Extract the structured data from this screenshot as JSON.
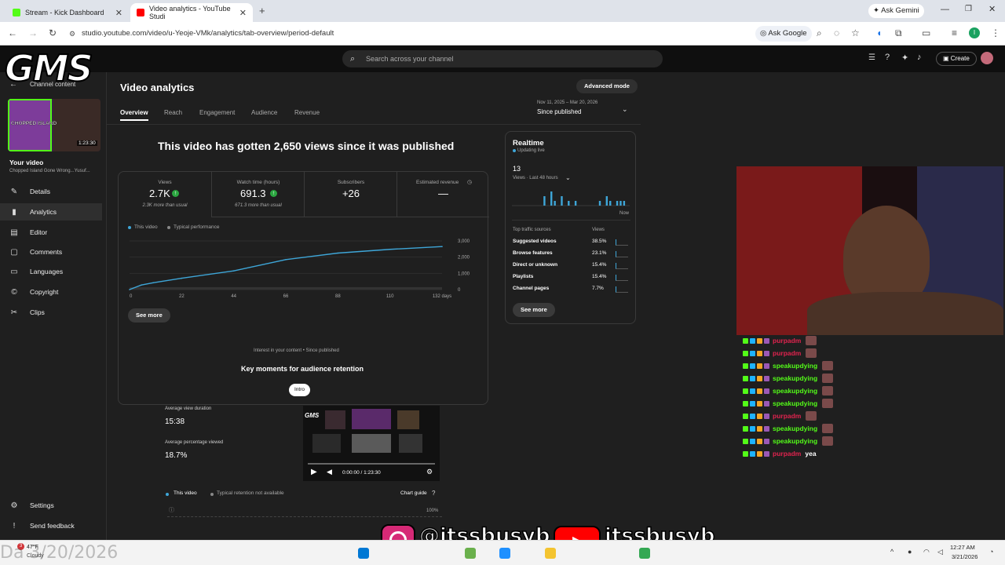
{
  "browser": {
    "tabs": [
      {
        "title": "Stream - Kick Dashboard",
        "favicon_color": "#53fc18"
      },
      {
        "title": "Video analytics - YouTube Studi",
        "favicon_color": "#ff0000"
      }
    ],
    "new_tab": "+",
    "url": "studio.youtube.com/video/u-Yeoje-VMk/analytics/tab-overview/period-default",
    "ask_google": "Ask Google",
    "ask_gemini": "Ask Gemini",
    "profile_initial": "I"
  },
  "studio": {
    "search_placeholder": "Search across your channel",
    "create_label": "Create",
    "sidebar": {
      "channel_content": "Channel content",
      "thumb_title": "CHOPPED ISLAND",
      "thumb_duration": "1:23:30",
      "your_video": "Your video",
      "video_title": "Chopped Island Gone Wrong...Yusuf...",
      "items": [
        {
          "label": "Details",
          "icon": "pencil-icon"
        },
        {
          "label": "Analytics",
          "icon": "analytics-icon"
        },
        {
          "label": "Editor",
          "icon": "editor-icon"
        },
        {
          "label": "Comments",
          "icon": "comments-icon"
        },
        {
          "label": "Languages",
          "icon": "subtitles-icon"
        },
        {
          "label": "Copyright",
          "icon": "copyright-icon"
        },
        {
          "label": "Clips",
          "icon": "scissors-icon"
        }
      ],
      "settings": "Settings",
      "send_feedback": "Send feedback"
    },
    "analytics": {
      "title": "Video analytics",
      "advanced_mode": "Advanced mode",
      "tabs": [
        "Overview",
        "Reach",
        "Engagement",
        "Audience",
        "Revenue"
      ],
      "period_range": "Nov 11, 2025 – Mar 20, 2026",
      "period_label": "Since published",
      "headline": "This video has gotten 2,650 views since it was published",
      "metrics": [
        {
          "label": "Views",
          "value": "2.7K",
          "note": "2.3K more than usual",
          "up": true
        },
        {
          "label": "Watch time (hours)",
          "value": "691.3",
          "note": "671.3 more than usual",
          "up": true
        },
        {
          "label": "Subscribers",
          "value": "+26",
          "note": "",
          "up": false
        },
        {
          "label": "Estimated revenue",
          "value": "—",
          "note": "",
          "up": false
        }
      ],
      "legend_this": "This video",
      "legend_typical": "Typical performance",
      "see_more": "See more",
      "interest_note": "Interest in your content • Since published",
      "key_moments": "Key moments for audience retention",
      "intro_chip": "Intro",
      "avg_view_duration_label": "Average view duration",
      "avg_view_duration": "15:38",
      "avg_pct_label": "Average percentage viewed",
      "avg_pct": "18.7%",
      "player_time": "0:00:00 / 1:23:30",
      "retention_this": "This video",
      "retention_typical": "Typical retention not available",
      "chart_guide": "Chart guide",
      "retention_100": "100%"
    },
    "realtime": {
      "title": "Realtime",
      "updating": "Updating live",
      "views_count": "13",
      "views_label": "Views · Last 48 hours",
      "now": "Now",
      "sources_header": "Top traffic sources",
      "views_header": "Views",
      "sources": [
        {
          "name": "Suggested videos",
          "pct": "38.5%"
        },
        {
          "name": "Browse features",
          "pct": "23.1%"
        },
        {
          "name": "Direct or unknown",
          "pct": "15.4%"
        },
        {
          "name": "Playlists",
          "pct": "15.4%"
        },
        {
          "name": "Channel pages",
          "pct": "7.7%"
        }
      ],
      "bars": [
        0,
        0,
        0,
        0,
        0,
        0,
        0,
        0,
        0,
        2,
        0,
        3,
        1,
        0,
        2,
        0,
        1,
        0,
        1,
        0,
        0,
        0,
        0,
        0,
        0,
        1,
        0,
        2,
        1,
        0,
        1,
        1,
        1,
        0
      ]
    }
  },
  "chart_data": {
    "type": "line",
    "x": [
      0,
      5,
      10,
      22,
      44,
      66,
      88,
      110,
      132
    ],
    "series": [
      {
        "name": "This video",
        "values": [
          0,
          280,
          420,
          700,
          1150,
          1850,
          2250,
          2480,
          2650
        ]
      }
    ],
    "x_ticks": [
      "0",
      "22",
      "44",
      "66",
      "88",
      "110",
      "132 days"
    ],
    "y_ticks": [
      "0",
      "1,000",
      "2,000",
      "3,000"
    ],
    "ylim": [
      0,
      3000
    ]
  },
  "overlay": {
    "gms": "GMS",
    "instagram": "@itssbusyb",
    "youtube": "itssbusyb",
    "chat": [
      {
        "user": "purpadm",
        "color": "#e0234e",
        "msg": ""
      },
      {
        "user": "purpadm",
        "color": "#e0234e",
        "msg": ""
      },
      {
        "user": "speakupdying",
        "color": "#53fc18",
        "msg": ""
      },
      {
        "user": "speakupdying",
        "color": "#53fc18",
        "msg": ""
      },
      {
        "user": "speakupdying",
        "color": "#53fc18",
        "msg": ""
      },
      {
        "user": "speakupdying",
        "color": "#53fc18",
        "msg": ""
      },
      {
        "user": "purpadm",
        "color": "#e0234e",
        "msg": ""
      },
      {
        "user": "speakupdying",
        "color": "#53fc18",
        "msg": ""
      },
      {
        "user": "speakupdying",
        "color": "#53fc18",
        "msg": ""
      },
      {
        "user": "purpadm",
        "color": "#e0234e",
        "msg": "yea"
      }
    ],
    "date_watermark": "Da 3/20/2026"
  },
  "taskbar": {
    "weather_temp": "47°F",
    "weather_desc": "Cloudy",
    "weather_badge": "3",
    "time": "12:27 AM",
    "date": "3/21/2026"
  }
}
